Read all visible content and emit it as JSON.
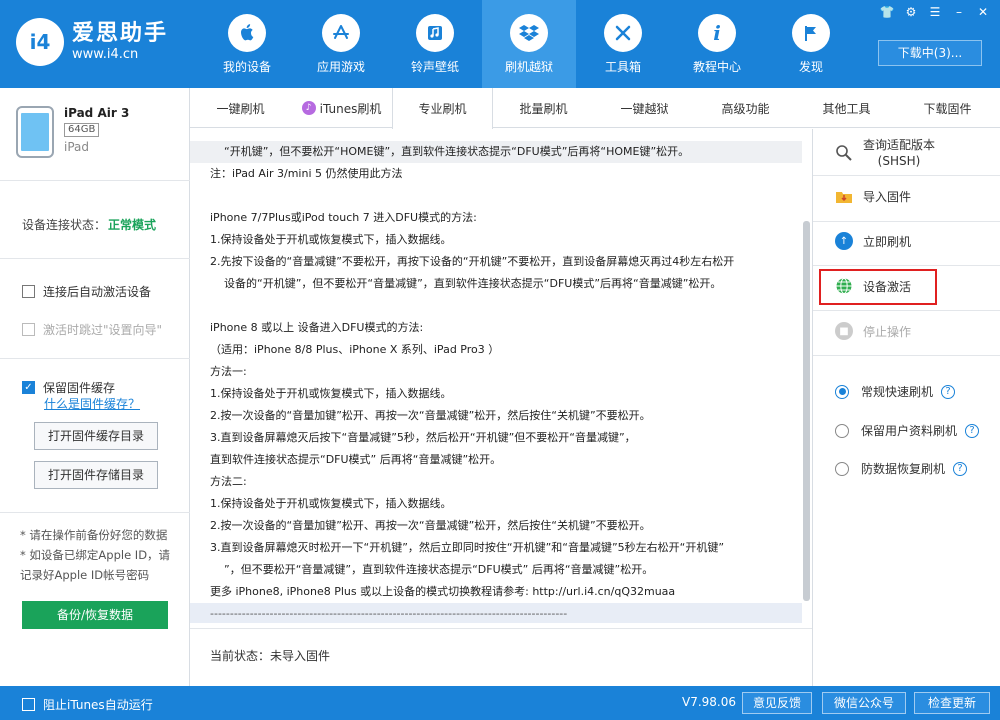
{
  "app": {
    "logo_badge": "i4",
    "name": "爱思助手",
    "url": "www.i4.cn"
  },
  "nav": [
    {
      "label": "我的设备",
      "icon": "apple-icon"
    },
    {
      "label": "应用游戏",
      "icon": "app-store-icon"
    },
    {
      "label": "铃声壁纸",
      "icon": "music-note-icon"
    },
    {
      "label": "刷机越狱",
      "icon": "dropbox-icon"
    },
    {
      "label": "工具箱",
      "icon": "tools-icon"
    },
    {
      "label": "教程中心",
      "icon": "info-icon"
    },
    {
      "label": "发现",
      "icon": "flag-icon"
    }
  ],
  "download_label": "下载中(3)...",
  "device": {
    "name": "iPad Air 3",
    "capacity": "64GB",
    "type": "iPad"
  },
  "connection": {
    "label": "设备连接状态：",
    "value": "正常模式"
  },
  "sidebar": {
    "auto_activate": "连接后自动激活设备",
    "skip_setup": "激活时跳过\"设置向导\"",
    "keep_cache": "保留固件缓存",
    "what_is_cache": "什么是固件缓存？",
    "open_cache_dir": "打开固件缓存目录",
    "open_storage_dir": "打开固件存储目录",
    "note_lines": [
      "* 请在操作前备份好您的数据",
      "* 如设备已绑定Apple ID，请",
      "记录好Apple ID帐号密码"
    ],
    "backup_btn": "备份/恢复数据"
  },
  "tabs": [
    "一键刷机",
    "iTunes刷机",
    "专业刷机",
    "批量刷机",
    "一键越狱",
    "高级功能",
    "其他工具",
    "下载固件"
  ],
  "content_lines": [
    "“开机键”，但不要松开“HOME键”，直到软件连接状态提示“DFU模式”后再将“HOME键”松开。",
    "注：iPad Air 3/mini 5 仍然使用此方法",
    "",
    "iPhone 7/7Plus或iPod touch 7 进入DFU模式的方法:",
    "1.保持设备处于开机或恢复模式下，插入数据线。",
    "2.先按下设备的“音量减键”不要松开，再按下设备的“开机键”不要松开，直到设备屏幕熄灭再过4秒左右松开",
    "设备的“开机键”，但不要松开“音量减键”，直到软件连接状态提示“DFU模式”后再将“音量减键”松开。",
    "",
    "iPhone 8 或以上 设备进入DFU模式的方法:",
    "（适用：iPhone 8/8 Plus、iPhone X 系列、iPad Pro3 ）",
    "方法一:",
    "1.保持设备处于开机或恢复模式下，插入数据线。",
    "2.按一次设备的“音量加键”松开、再按一次“音量减键”松开，然后按住“关机键”不要松开。",
    "3.直到设备屏幕熄灭后按下“音量减键”5秒，然后松开“开机键”但不要松开“音量减键”，",
    "直到软件连接状态提示“DFU模式” 后再将“音量减键”松开。",
    "方法二:",
    "1.保持设备处于开机或恢复模式下，插入数据线。",
    "2.按一次设备的“音量加键”松开、再按一次“音量减键”松开，然后按住“关机键”不要松开。",
    "3.直到设备屏幕熄灭时松开一下“开机键”，然后立即同时按住“开机键”和“音量减键”5秒左右松开“开机键”",
    "”，但不要松开“音量减键”，直到软件连接状态提示“DFU模式” 后再将“音量减键”松开。",
    "更多 iPhone8, iPhone8 Plus 或以上设备的模式切换教程请参考: http://url.i4.cn/qQ32muaa",
    "------------------------------------------------------------------------------------------"
  ],
  "status": {
    "text": "当前状态：未导入固件"
  },
  "right_panel": {
    "query": [
      "查询适配版本",
      "(SHSH)"
    ],
    "import": "导入固件",
    "flash_now": "立即刷机",
    "activate": "设备激活",
    "stop": "停止操作",
    "modes": [
      {
        "label": "常规快速刷机",
        "selected": true
      },
      {
        "label": "保留用户资料刷机",
        "selected": false
      },
      {
        "label": "防数据恢复刷机",
        "selected": false
      }
    ]
  },
  "footer": {
    "block_itunes": "阻止iTunes自动运行",
    "version": "V7.98.06",
    "feedback": "意见反馈",
    "wechat": "微信公众号",
    "update": "检查更新"
  },
  "colors": {
    "brand_blue": "#1a82d8",
    "green": "#1aa35a",
    "highlight_red": "#e02020"
  }
}
